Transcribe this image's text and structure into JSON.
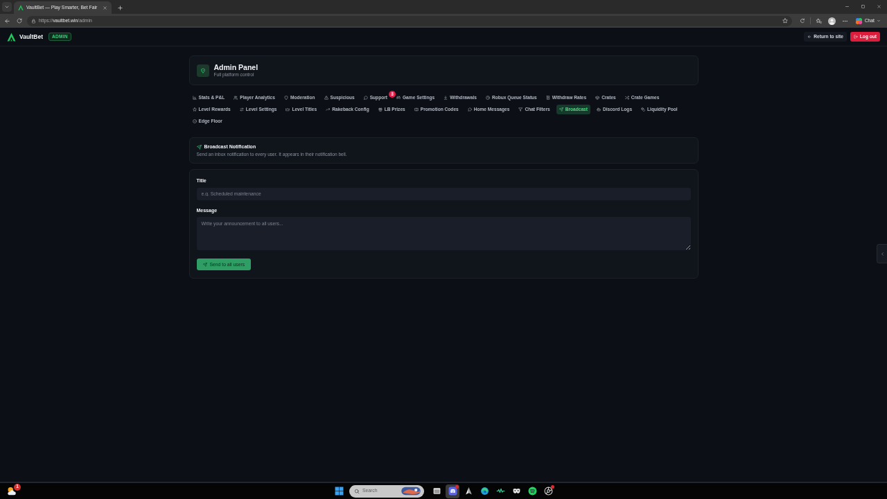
{
  "browser": {
    "tabs": [
      {
        "title": "VaultBet — Play Smarter, Bet Fair",
        "selected": true
      }
    ],
    "address": {
      "scheme": "https://",
      "host": "vaultbet.win",
      "path": "/admin"
    },
    "chat_button": "Chat"
  },
  "header": {
    "brand": "VaultBet",
    "role_badge": "ADMIN",
    "return_button": "Return to site",
    "logout_button": "Log out"
  },
  "panel": {
    "title": "Admin Panel",
    "subtitle": "Full platform control"
  },
  "nav_tabs": [
    {
      "label": "Stats & P&L",
      "selected": false
    },
    {
      "label": "Player Analytics",
      "selected": false
    },
    {
      "label": "Moderation",
      "selected": false
    },
    {
      "label": "Suspicious",
      "selected": false
    },
    {
      "label": "Support",
      "selected": false,
      "badge": "3"
    },
    {
      "label": "Game Settings",
      "selected": false
    },
    {
      "label": "Withdrawals",
      "selected": false
    },
    {
      "label": "Robux Queue Status",
      "selected": false
    },
    {
      "label": "Withdraw Rates",
      "selected": false
    },
    {
      "label": "Crates",
      "selected": false
    },
    {
      "label": "Crate Games",
      "selected": false
    },
    {
      "label": "Level Rewards",
      "selected": false
    },
    {
      "label": "Level Settings",
      "selected": false
    },
    {
      "label": "Level Titles",
      "selected": false
    },
    {
      "label": "Rakeback Config",
      "selected": false
    },
    {
      "label": "LB Prizes",
      "selected": false
    },
    {
      "label": "Promotion Codes",
      "selected": false
    },
    {
      "label": "Home Messages",
      "selected": false
    },
    {
      "label": "Chat Filters",
      "selected": false
    },
    {
      "label": "Broadcast",
      "selected": true
    },
    {
      "label": "Discord Logs",
      "selected": false
    },
    {
      "label": "Liquidity Pool",
      "selected": false
    },
    {
      "label": "Edge Floor",
      "selected": false
    }
  ],
  "broadcast": {
    "title": "Broadcast Notification",
    "description": "Send an inbox notification to every user. It appears in their notification bell."
  },
  "form": {
    "fields": [
      {
        "kind": "input",
        "label": "Title",
        "placeholder": "e.g. Scheduled maintenance"
      },
      {
        "kind": "textarea",
        "label": "Message",
        "placeholder": "Write your announcement to all users..."
      }
    ],
    "submit_button": "Send to all users"
  },
  "taskbar": {
    "widget_badge": "1",
    "search_placeholder": "Search",
    "apps": [
      {
        "selected": false,
        "notification": false
      },
      {
        "selected": true,
        "notification": true
      },
      {
        "selected": false,
        "notification": false
      },
      {
        "selected": false,
        "notification": false
      },
      {
        "selected": false,
        "notification": false
      },
      {
        "selected": false,
        "notification": false
      },
      {
        "selected": false,
        "notification": false
      },
      {
        "selected": false,
        "notification": true
      }
    ]
  }
}
